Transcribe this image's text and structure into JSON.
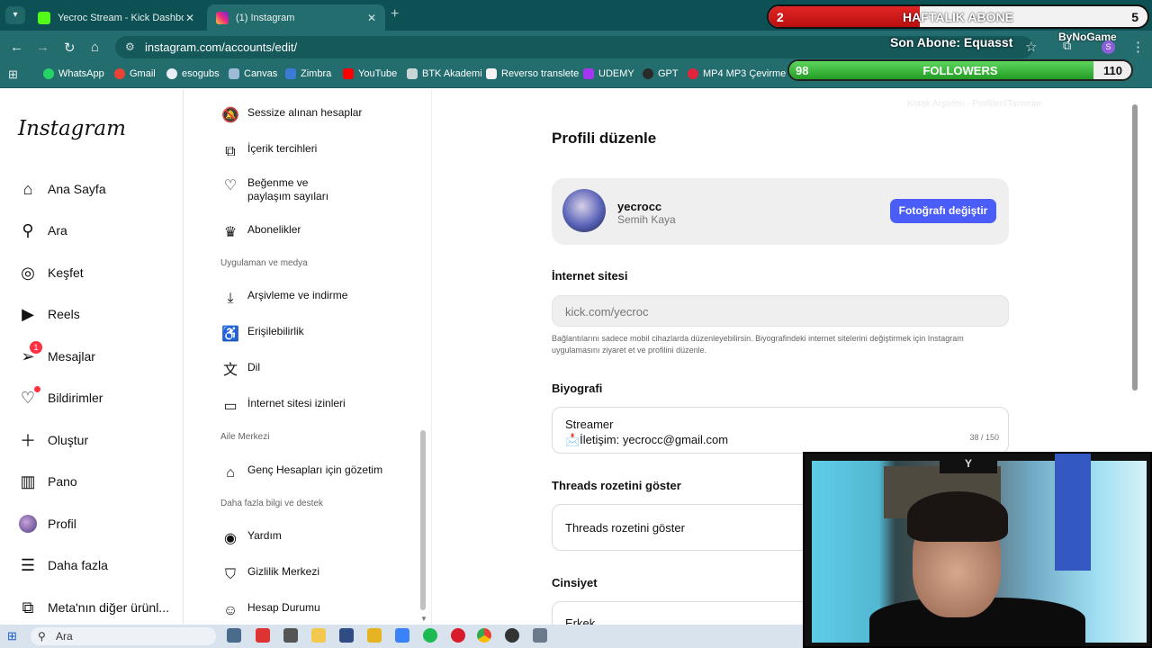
{
  "browser": {
    "tabs": [
      {
        "label": "Yecroc Stream - Kick Dashboard",
        "color": "#53fc18"
      },
      {
        "label": "(1) Instagram",
        "color": "#e1306c"
      }
    ],
    "url": "instagram.com/accounts/edit/",
    "bookmarks": [
      "WhatsApp",
      "Gmail",
      "esogubs",
      "Canvas",
      "Zimbra",
      "YouTube",
      "BTK Akademi",
      "Reverso translete",
      "UDEMY",
      "GPT",
      "MP4 MP3 Çevirme"
    ]
  },
  "overlay": {
    "abone": {
      "left": "2",
      "title": "HAFTALIK ABONE",
      "right": "5",
      "progress": 0.4
    },
    "son_abone": "Son Abone: Equasst",
    "sponsor": "ByNoGame",
    "followers": {
      "left": "98",
      "title": "FOLLOWERS",
      "right": "110",
      "progress": 0.89
    },
    "profile_initial": "S",
    "webcam_logo": "Y"
  },
  "sidebar": {
    "logo": "Instagram",
    "items": [
      {
        "label": "Ana Sayfa",
        "icon": "home-icon"
      },
      {
        "label": "Ara",
        "icon": "search-icon"
      },
      {
        "label": "Keşfet",
        "icon": "compass-icon"
      },
      {
        "label": "Reels",
        "icon": "reels-icon"
      },
      {
        "label": "Mesajlar",
        "icon": "messages-icon",
        "badge": "1"
      },
      {
        "label": "Bildirimler",
        "icon": "heart-icon"
      },
      {
        "label": "Oluştur",
        "icon": "plus-icon"
      },
      {
        "label": "Pano",
        "icon": "dashboard-icon"
      },
      {
        "label": "Profil",
        "icon": "profile-icon"
      },
      {
        "label": "Daha fazla",
        "icon": "menu-icon"
      },
      {
        "label": "Meta'nın diğer ürünl...",
        "icon": "meta-icon"
      }
    ]
  },
  "settings": {
    "items_top": [
      {
        "label": "Sessize alınan hesaplar",
        "icon": "muted-bell-icon"
      },
      {
        "label": "İçerik tercihleri",
        "icon": "content-icon"
      },
      {
        "label": "Beğenme ve paylaşım sayıları",
        "icon": "heart-off-icon"
      },
      {
        "label": "Abonelikler",
        "icon": "crown-icon"
      }
    ],
    "head_media": "Uygulaman ve medya",
    "items_media": [
      {
        "label": "Arşivleme ve indirme",
        "icon": "download-icon"
      },
      {
        "label": "Erişilebilirlik",
        "icon": "accessibility-icon"
      },
      {
        "label": "Dil",
        "icon": "language-icon"
      },
      {
        "label": "İnternet sitesi izinleri",
        "icon": "website-icon"
      }
    ],
    "head_family": "Aile Merkezi",
    "items_family": [
      {
        "label": "Genç Hesapları için gözetim",
        "icon": "family-home-icon"
      }
    ],
    "head_help": "Daha fazla bilgi ve destek",
    "items_help": [
      {
        "label": "Yardım",
        "icon": "lifebuoy-icon"
      },
      {
        "label": "Gizlilik Merkezi",
        "icon": "shield-star-icon"
      },
      {
        "label": "Hesap Durumu",
        "icon": "person-icon"
      }
    ]
  },
  "edit": {
    "faded_top": "Kotak Arşivleri - Profilleri/Tanımlar",
    "title": "Profili düzenle",
    "username": "yecrocc",
    "fullname": "Semih Kaya",
    "change_photo": "Fotoğrafı değiştir",
    "website_label": "İnternet sitesi",
    "website_value": "kick.com/yecroc",
    "website_hint": "Bağlantılarını sadece mobil cihazlarda düzenleyebilirsin. Biyografindeki internet sitelerini değiştirmek için Instagram uygulamasını ziyaret et ve profilini düzenle.",
    "bio_label": "Biyografi",
    "bio_line1": "Streamer",
    "bio_line2": "📩İletişim: yecrocc@gmail.com",
    "bio_counter": "38 / 150",
    "threads_label": "Threads rozetini göster",
    "threads_value": "Threads rozetini göster",
    "gender_label": "Cinsiyet",
    "gender_value": "Erkek"
  },
  "taskbar": {
    "search": "Ara"
  }
}
